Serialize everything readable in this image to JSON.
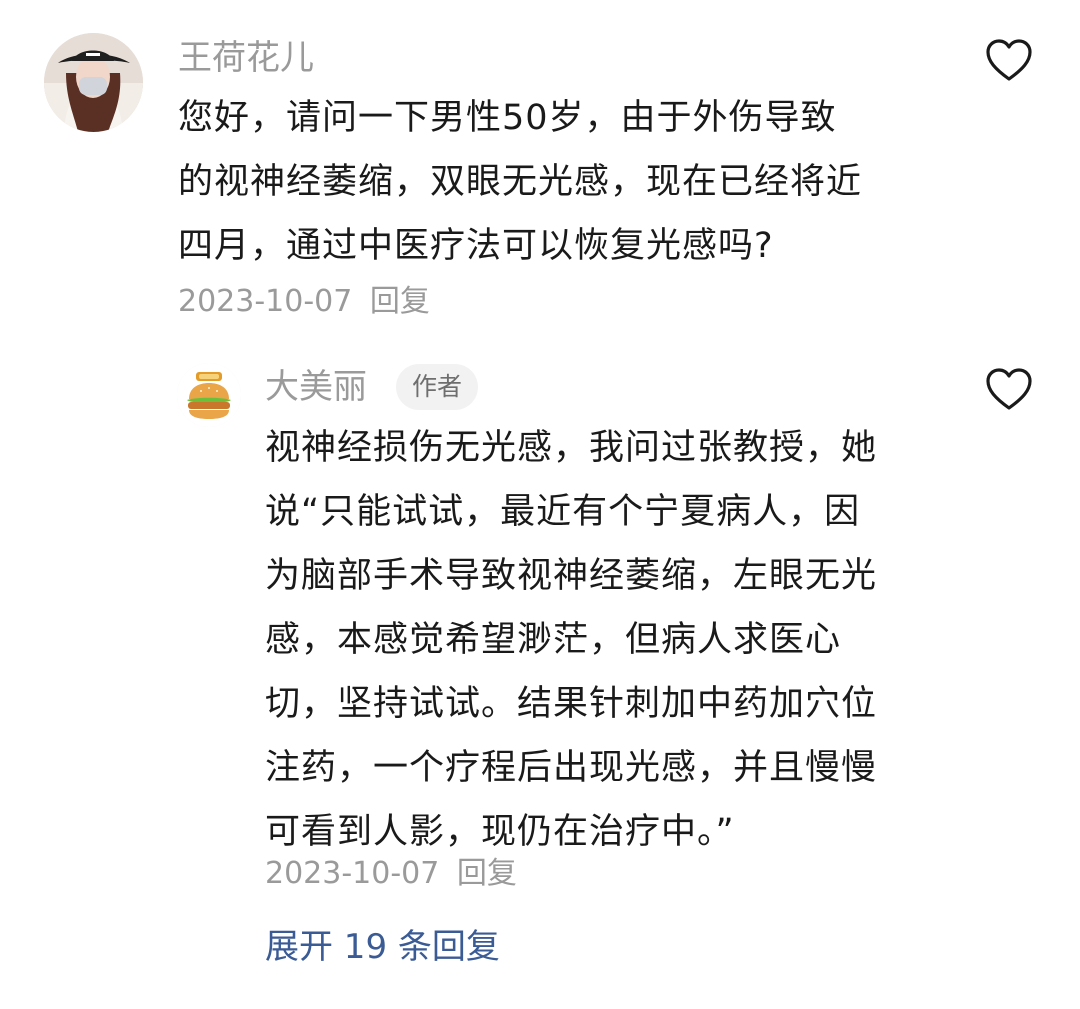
{
  "comment": {
    "username": "王荷花儿",
    "avatar_icon": "user-photo-avatar",
    "lines": [
      "您好，请问一下男性50岁，由于外伤导致",
      "的视神经萎缩，双眼无光感，现在已经将近",
      "四月，通过中医疗法可以恢复光感吗?"
    ],
    "date": "2023-10-07",
    "reply_label": "回复",
    "like_icon": "heart-outline-icon"
  },
  "reply": {
    "username": "大美丽",
    "badge": "作者",
    "avatar_icon": "burger-avatar",
    "lines": [
      "视神经损伤无光感，我问过张教授，她",
      "说“只能试试，最近有个宁夏病人，因",
      "为脑部手术导致视神经萎缩，左眼无光",
      "感，本感觉希望渺茫，但病人求医心",
      "切，坚持试试。结果针刺加中药加穴位",
      "注药，一个疗程后出现光感，并且慢慢",
      "可看到人影，现仍在治疗中。”"
    ],
    "date": "2023-10-07",
    "reply_label": "回复",
    "like_icon": "heart-outline-icon"
  },
  "expand_label": "展开 19 条回复",
  "colors": {
    "secondary_text": "#9a9a9a",
    "body_text": "#1a1a1a",
    "link": "#3b5b95",
    "badge_bg": "#f2f2f2"
  }
}
